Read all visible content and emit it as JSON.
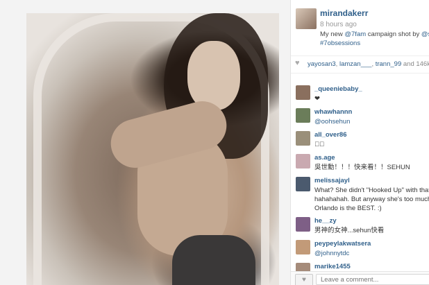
{
  "post": {
    "username": "mirandakerr",
    "time": "8 hours ago",
    "caption_prefix": "My new ",
    "caption_mention_1": "@7fam",
    "caption_middle": " campaign shot by ",
    "caption_mention_2": "@s",
    "caption_hashtag": "#7obsessions"
  },
  "likes": {
    "names": [
      "yayosan3",
      "lamzan___",
      "trann_99"
    ],
    "count_text": "and 146k"
  },
  "comments": [
    {
      "user": "_queeniebaby_",
      "text": "❤",
      "avatar_color": "#8a6f5e",
      "link": false
    },
    {
      "user": "whawhannn",
      "text": "@oohsehun",
      "avatar_color": "#6b7d5a",
      "link": true
    },
    {
      "user": "all_over86",
      "text": "❤⃣",
      "avatar_color": "#9a8f7a",
      "link": false
    },
    {
      "user": "as.age",
      "text": "吳世勳！！！快来看！！SEHUN",
      "avatar_color": "#c9a9b0",
      "link": false
    },
    {
      "user": "melissajayl",
      "text_lines": [
        "What? She didn't \"Hooked Up\" with that",
        "hahahahah. But anyway she's too much",
        "Orlando is the BEST. :)"
      ],
      "avatar_color": "#4b5a6e",
      "link": false
    },
    {
      "user": "he__zy",
      "text": "男神的女神...sehun快看",
      "avatar_color": "#7e5f86",
      "link": false
    },
    {
      "user": "peypeylakwatsera",
      "text": "@johnnytdc",
      "avatar_color": "#c29a78",
      "link": true
    },
    {
      "user": "marike1455",
      "text": "",
      "avatar_color": "#a58b7a",
      "link": false
    }
  ],
  "comment_bar": {
    "like_label": "♥",
    "placeholder": "Leave a comment..."
  },
  "colors": {
    "link": "#2f5f8a",
    "text": "#333333",
    "muted": "#999999"
  }
}
